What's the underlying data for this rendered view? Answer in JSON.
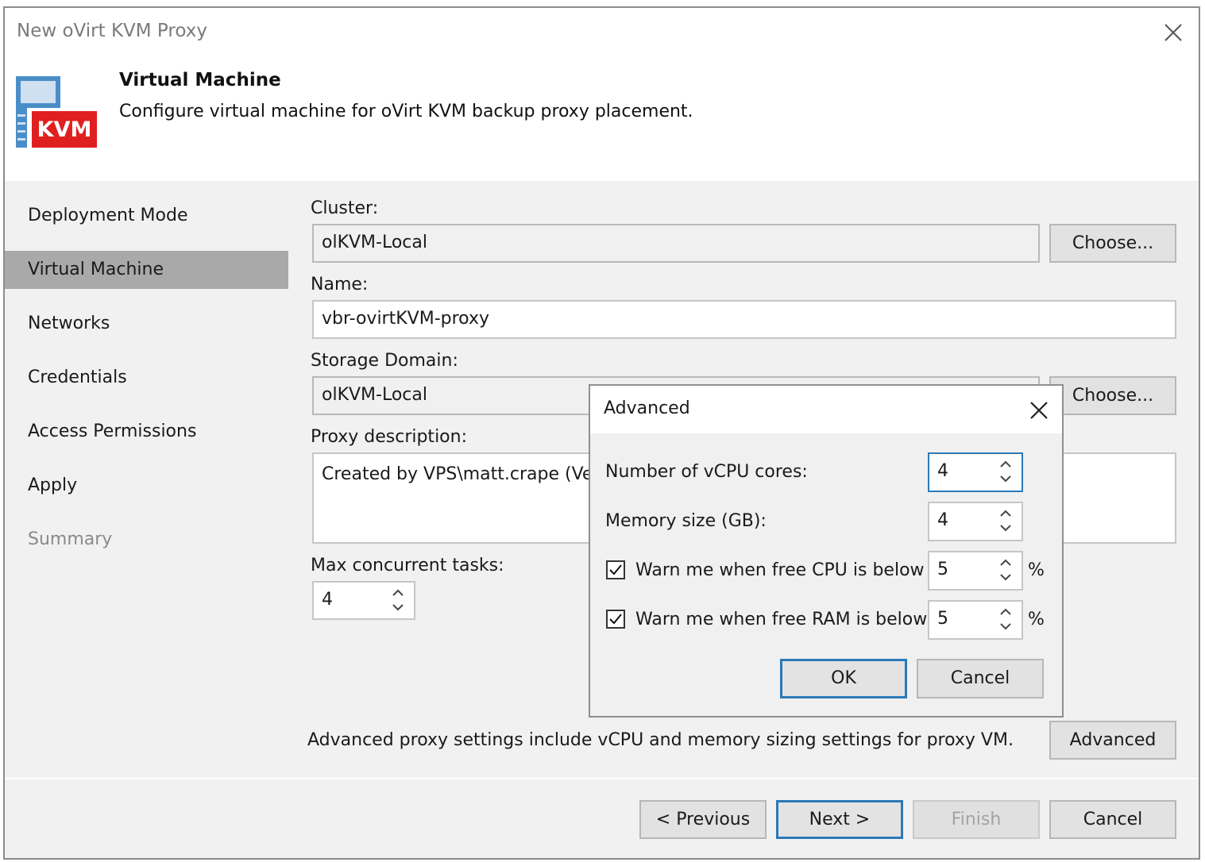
{
  "window": {
    "title": "New oVirt KVM Proxy",
    "header_title": "Virtual Machine",
    "header_subtitle": "Configure virtual machine for oVirt KVM backup proxy placement.",
    "icon_text": "KVM"
  },
  "nav": {
    "items": [
      {
        "label": "Deployment Mode"
      },
      {
        "label": "Virtual Machine"
      },
      {
        "label": "Networks"
      },
      {
        "label": "Credentials"
      },
      {
        "label": "Access Permissions"
      },
      {
        "label": "Apply"
      },
      {
        "label": "Summary"
      }
    ]
  },
  "form": {
    "cluster_label": "Cluster:",
    "cluster_value": "olKVM-Local",
    "choose_label": "Choose...",
    "name_label": "Name:",
    "name_value": "vbr-ovirtKVM-proxy",
    "storage_label": "Storage Domain:",
    "storage_value": "olKVM-Local",
    "description_label": "Proxy description:",
    "description_value": "Created by VPS\\matt.crape (Vee",
    "max_tasks_label": "Max concurrent tasks:",
    "max_tasks_value": "4",
    "advanced_text": "Advanced proxy settings include vCPU and memory sizing settings for proxy VM.",
    "advanced_button": "Advanced"
  },
  "footer": {
    "previous": "< Previous",
    "next": "Next >",
    "finish": "Finish",
    "cancel": "Cancel"
  },
  "modal": {
    "title": "Advanced",
    "vcpu_label": "Number of vCPU cores:",
    "vcpu_value": "4",
    "memory_label": "Memory size (GB):",
    "memory_value": "4",
    "cpu_warn_label": "Warn me when free CPU is below",
    "cpu_warn_checked": true,
    "cpu_warn_value": "5",
    "ram_warn_label": "Warn me when free RAM is below",
    "ram_warn_checked": true,
    "ram_warn_value": "5",
    "percent": "%",
    "ok": "OK",
    "cancel": "Cancel"
  },
  "colors": {
    "accent_border": "#2b79b8",
    "nav_active": "#a9a9a9",
    "kvm_red": "#e0201f",
    "kvm_blue": "#4a8ec8"
  }
}
